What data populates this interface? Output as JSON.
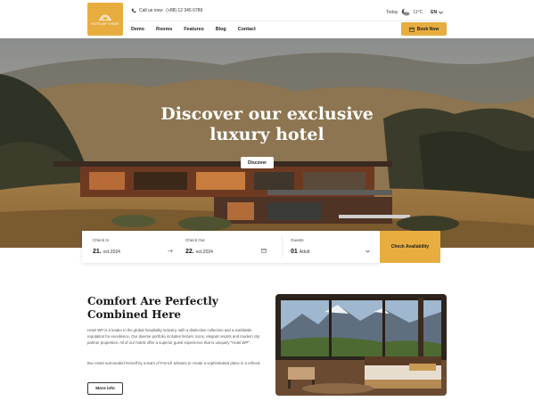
{
  "header": {
    "logo_text": "HOTELWP THEME",
    "phone_label": "Call us now:",
    "phone_number": "(+88) 12 345 6789",
    "today_label": "Today",
    "temperature": "11°C",
    "language": "EN",
    "menu": [
      "Demo",
      "Rooms",
      "Features",
      "Blog",
      "Contact"
    ],
    "book_now": "Book Now"
  },
  "hero": {
    "title_line1": "Discover our exclusive",
    "title_line2": "luxury hotel",
    "button": "Discover"
  },
  "booking": {
    "checkin_label": "Check In",
    "checkin_day": "21.",
    "checkin_monthyear": "oct,2024",
    "checkout_label": "Check Out",
    "checkout_day": "22.",
    "checkout_monthyear": "oct,2024",
    "guests_label": "Guests",
    "guests_count": "01",
    "guests_type": "Adult",
    "submit": "Check Availability"
  },
  "about": {
    "title_line1": "Comfort Are Perfectly",
    "title_line2": "Combined Here",
    "paragraph1": "Hotel WP is a leader in the global hospitality industry, with a distinctive collection and a worldwide reputation for excellence. Our diverse portfolio includes historic icons, elegant resorts and modern city partner properties. All of our hotels offer a superior guest experience that is uniquely \"Hotel WP\".",
    "paragraph2": "Boo Hotel surrounded herself by a team of French artisans to create a sophisticated place in a refined.",
    "more_info": "More info"
  },
  "colors": {
    "accent": "#e8ad3f"
  },
  "icons": {
    "logo": "hotel-logo-icon",
    "phone": "phone-icon",
    "weather": "cloud-moon-icon",
    "language_caret": "chevron-down-icon",
    "calendar": "calendar-icon",
    "arrow": "arrow-right-icon"
  }
}
